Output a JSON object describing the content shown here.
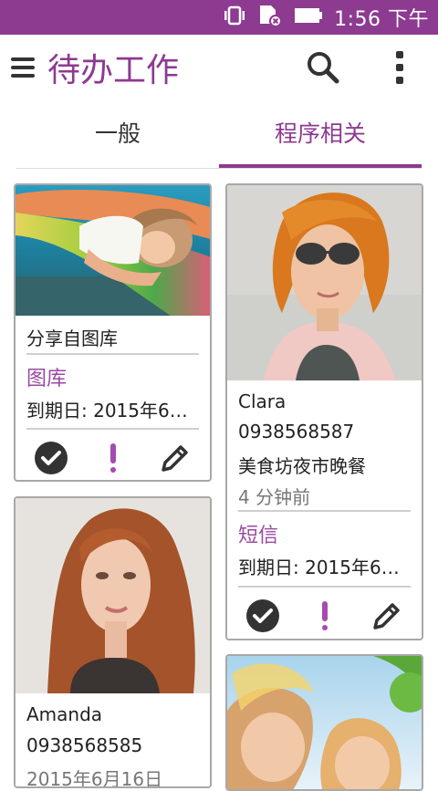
{
  "statusbar": {
    "time": "1:56 下午"
  },
  "appbar": {
    "title": "待办工作"
  },
  "tabs": [
    {
      "label": "一般"
    },
    {
      "label": "程序相关"
    }
  ],
  "cards": [
    {
      "source": "分享自图库",
      "category": "图库",
      "due": "到期日: 2015年6月2…"
    },
    {
      "name": "Clara",
      "phone": "0938568587",
      "note": "美食坊夜市晚餐",
      "time_ago": "4 分钟前",
      "category": "短信",
      "due": "到期日: 2015年6月2…"
    },
    {
      "name": "Amanda",
      "phone": "0938568585",
      "date": "2015年6月16日"
    }
  ],
  "colors": {
    "accent": "#8d3a91",
    "status_bar": "#8d3a91"
  }
}
